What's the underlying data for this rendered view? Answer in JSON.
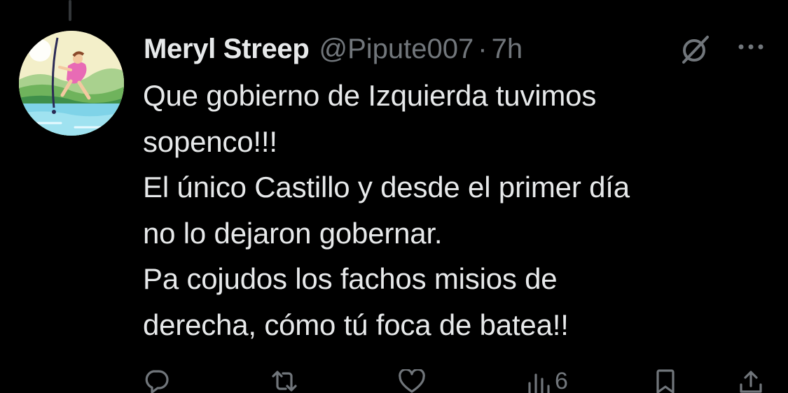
{
  "tweet": {
    "author": {
      "display_name": "Meryl Streep",
      "handle": "@Pipute007"
    },
    "separator": "·",
    "timestamp": "7h",
    "text": "Que gobierno de Izquierda tuvimos\nsopenco!!!\nEl único Castillo y desde el primer día\nno lo dejaron gobernar.\nPa cojudos los fachos misios de\nderecha,  cómo tú foca de batea!!"
  },
  "actions": {
    "reply": {
      "icon": "reply-icon"
    },
    "retweet": {
      "icon": "retweet-icon"
    },
    "like": {
      "icon": "heart-icon"
    },
    "views": {
      "icon": "views-icon",
      "count": "6"
    },
    "bookmark": {
      "icon": "bookmark-icon"
    },
    "share": {
      "icon": "share-icon"
    }
  },
  "colors": {
    "background": "#000000",
    "primary_text": "#e7e9ea",
    "secondary_text": "#71767b"
  }
}
